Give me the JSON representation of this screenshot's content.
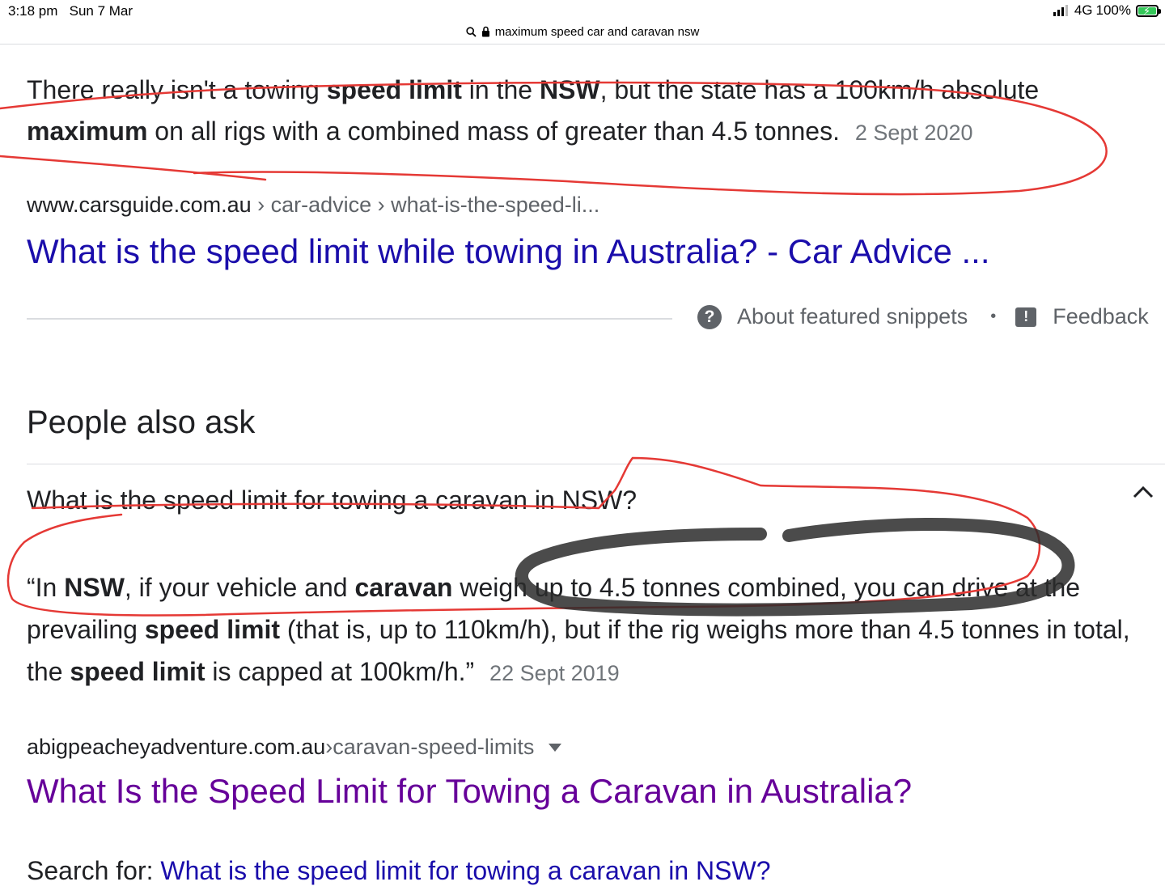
{
  "status_bar": {
    "time": "3:18 pm",
    "date": "Sun 7 Mar",
    "network": "4G",
    "battery": "100%",
    "battery_level": 1.0
  },
  "url_bar": {
    "query": "maximum speed car and caravan nsw"
  },
  "featured_snippet": {
    "parts": [
      "There really isn't a towing ",
      "speed limit",
      " in the ",
      "NSW",
      ", but the state has a 100km/h absolute ",
      "maximum",
      " on all rigs with a combined mass of greater than 4.5 tonnes."
    ],
    "date": "2 Sept 2020",
    "breadcrumb": {
      "domain": "www.carsguide.com.au",
      "sep": " › ",
      "path1": "car-advice",
      "path2": "what-is-the-speed-li..."
    },
    "link_title": "What is the speed limit while towing in Australia? - Car Advice ...",
    "about_label": "About featured snippets",
    "feedback_label": "Feedback"
  },
  "people_also_ask": {
    "title": "People also ask",
    "question": "What is the speed limit for towing a caravan in NSW?",
    "answer_parts": [
      "“In ",
      "NSW",
      ", if your vehicle and ",
      "caravan",
      " weigh up to 4.5 tonnes combined, you can drive at the prevailing ",
      "speed limit",
      " (that is, up to 110km/h), but if the rig weighs more than 4.5 tonnes in total, the ",
      "speed limit",
      " is capped at 100km/h.”"
    ],
    "date": "22 Sept 2019",
    "breadcrumb": {
      "domain": "abigpeacheyadventure.com.au",
      "sep": " › ",
      "path": "caravan-speed-limits"
    },
    "link_title": "What Is the Speed Limit for Towing a Caravan in Australia?",
    "search_for_label": "Search for: ",
    "search_for_query": "What is the speed limit for towing a caravan in NSW?"
  },
  "annotations": {
    "red_ink": "#e53935",
    "dark_ink": "#2b2b2b"
  }
}
